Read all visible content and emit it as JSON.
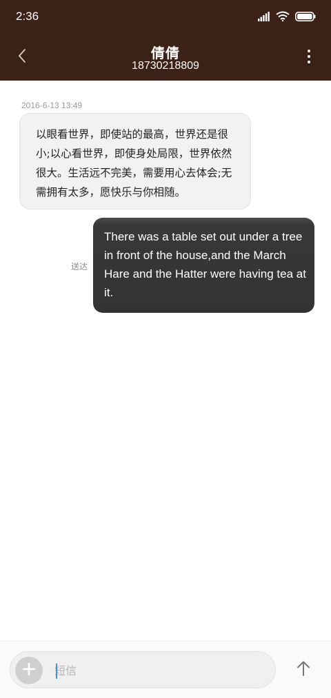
{
  "status_bar": {
    "time": "2:36",
    "icons": [
      "signal-icon",
      "wifi-icon",
      "battery-icon"
    ]
  },
  "header": {
    "contact_name": "倩倩",
    "phone_number": "18730218809",
    "back_icon": "chevron-left-icon",
    "menu_icon": "more-vertical-icon",
    "background_color": "#3b2116"
  },
  "conversation": {
    "timestamp": "2016-6-13 13:49",
    "messages": [
      {
        "direction": "incoming",
        "text": "以眼看世界，即使站的最高，世界还是很小;以心看世界，即使身处局限，世界依然很大。生活远不完美，需要用心去体会;无需拥有太多，愿快乐与你相随。"
      },
      {
        "direction": "outgoing",
        "text": "There was a table set out under a tree in front of the house,and the March Hare and the Hatter were having tea at it.",
        "status": "送达"
      }
    ]
  },
  "composer": {
    "placeholder": "短信",
    "value": "",
    "attach_icon": "plus-icon",
    "send_icon": "arrow-up-icon"
  }
}
